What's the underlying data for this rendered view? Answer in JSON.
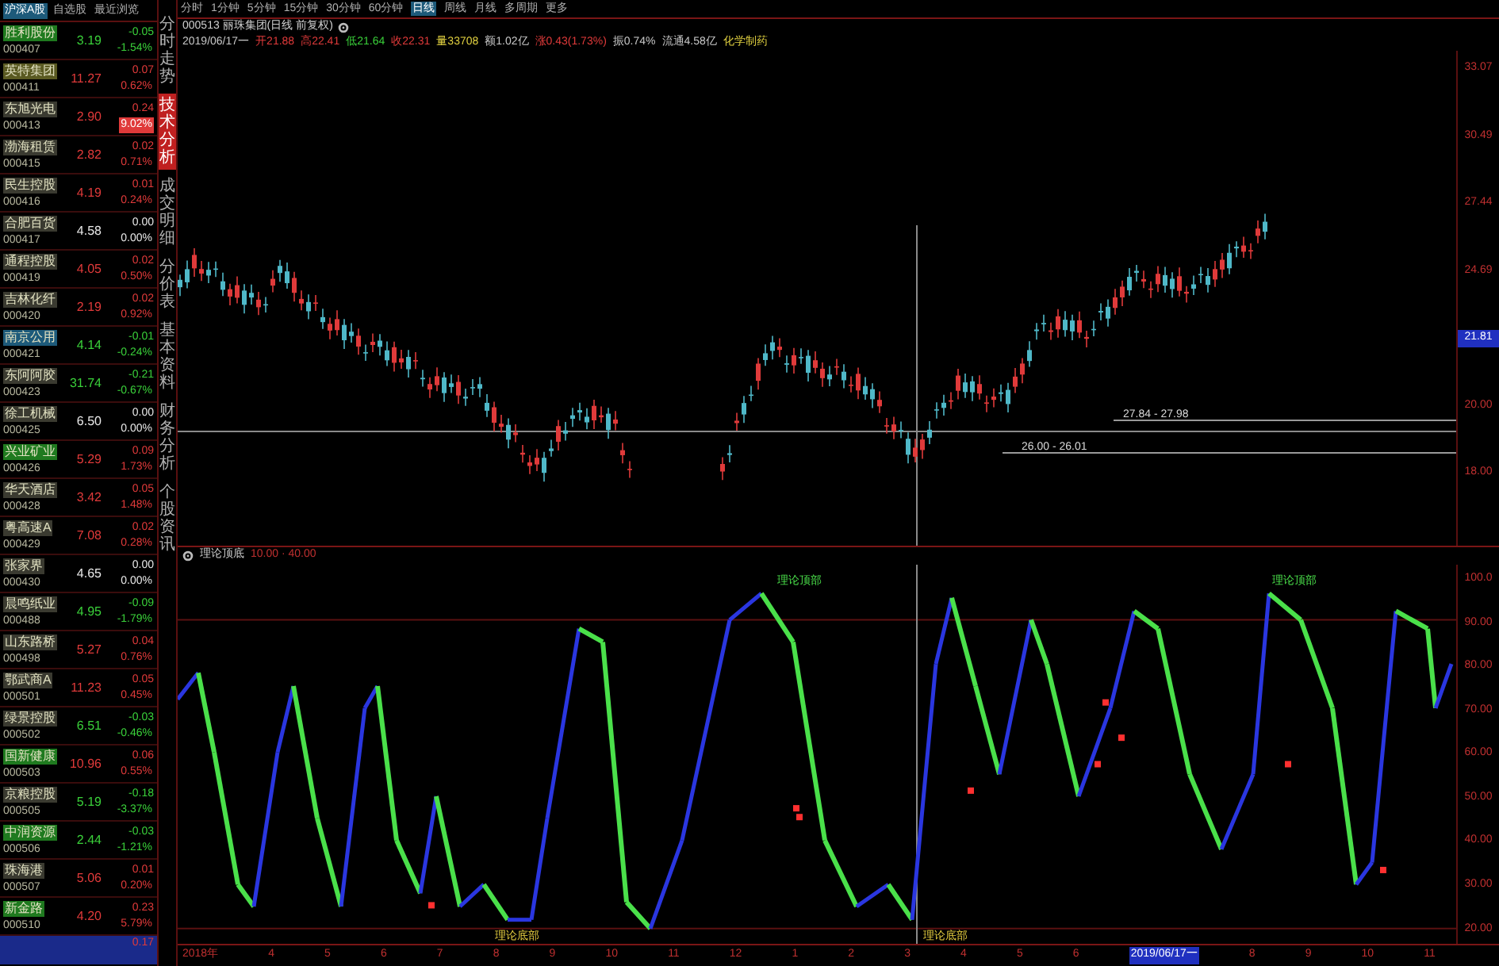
{
  "watchlist": {
    "tabs": [
      {
        "label": "沪深A股",
        "selected": true
      },
      {
        "label": "自选股",
        "selected": false
      },
      {
        "label": "最近浏览",
        "selected": false
      }
    ],
    "rows": [
      {
        "name": "胜利股份",
        "code": "000407",
        "price": "3.19",
        "change": "-0.05",
        "pct": "-1.54%",
        "kind": "down",
        "color": "#1f7a1f",
        "highlighted": false
      },
      {
        "name": "英特集团",
        "code": "000411",
        "price": "11.27",
        "change": "0.07",
        "pct": "0.62%",
        "kind": "up",
        "color": "#5a5a22",
        "highlighted": false
      },
      {
        "name": "东旭光电",
        "code": "000413",
        "price": "2.90",
        "change": "0.24",
        "pct": "9.02%",
        "kind": "up",
        "color": "#3a3a30",
        "highlighted": true
      },
      {
        "name": "渤海租赁",
        "code": "000415",
        "price": "2.82",
        "change": "0.02",
        "pct": "0.71%",
        "kind": "up",
        "color": "#3a3a30",
        "highlighted": false
      },
      {
        "name": "民生控股",
        "code": "000416",
        "price": "4.19",
        "change": "0.01",
        "pct": "0.24%",
        "kind": "up",
        "color": "#3a3a30",
        "highlighted": false
      },
      {
        "name": "合肥百货",
        "code": "000417",
        "price": "4.58",
        "change": "0.00",
        "pct": "0.00%",
        "kind": "flat",
        "color": "#3a3a30",
        "highlighted": false
      },
      {
        "name": "通程控股",
        "code": "000419",
        "price": "4.05",
        "change": "0.02",
        "pct": "0.50%",
        "kind": "up",
        "color": "#3a3a30",
        "highlighted": false
      },
      {
        "name": "吉林化纤",
        "code": "000420",
        "price": "2.19",
        "change": "0.02",
        "pct": "0.92%",
        "kind": "up",
        "color": "#3a3a30",
        "highlighted": false
      },
      {
        "name": "南京公用",
        "code": "000421",
        "price": "4.14",
        "change": "-0.01",
        "pct": "-0.24%",
        "kind": "down",
        "color": "#1d5a7a",
        "highlighted": false
      },
      {
        "name": "东阿阿胶",
        "code": "000423",
        "price": "31.74",
        "change": "-0.21",
        "pct": "-0.67%",
        "kind": "down",
        "color": "#3a3a30",
        "highlighted": false
      },
      {
        "name": "徐工机械",
        "code": "000425",
        "price": "6.50",
        "change": "0.00",
        "pct": "0.00%",
        "kind": "flat",
        "color": "#3a3a30",
        "highlighted": false
      },
      {
        "name": "兴业矿业",
        "code": "000426",
        "price": "5.29",
        "change": "0.09",
        "pct": "1.73%",
        "kind": "up",
        "color": "#1f7a1f",
        "highlighted": false
      },
      {
        "name": "华天酒店",
        "code": "000428",
        "price": "3.42",
        "change": "0.05",
        "pct": "1.48%",
        "kind": "up",
        "color": "#3a3a30",
        "highlighted": false
      },
      {
        "name": "粤高速A",
        "code": "000429",
        "price": "7.08",
        "change": "0.02",
        "pct": "0.28%",
        "kind": "up",
        "color": "#3a3a30",
        "highlighted": false
      },
      {
        "name": "张家界",
        "code": "000430",
        "price": "4.65",
        "change": "0.00",
        "pct": "0.00%",
        "kind": "flat",
        "color": "#3a3a30",
        "highlighted": false
      },
      {
        "name": "晨鸣纸业",
        "code": "000488",
        "price": "4.95",
        "change": "-0.09",
        "pct": "-1.79%",
        "kind": "down",
        "color": "#3a3a30",
        "highlighted": false
      },
      {
        "name": "山东路桥",
        "code": "000498",
        "price": "5.27",
        "change": "0.04",
        "pct": "0.76%",
        "kind": "up",
        "color": "#3a3a30",
        "highlighted": false
      },
      {
        "name": "鄂武商A",
        "code": "000501",
        "price": "11.23",
        "change": "0.05",
        "pct": "0.45%",
        "kind": "up",
        "color": "#3a3a30",
        "highlighted": false
      },
      {
        "name": "绿景控股",
        "code": "000502",
        "price": "6.51",
        "change": "-0.03",
        "pct": "-0.46%",
        "kind": "down",
        "color": "#3a3a30",
        "highlighted": false
      },
      {
        "name": "国新健康",
        "code": "000503",
        "price": "10.96",
        "change": "0.06",
        "pct": "0.55%",
        "kind": "up",
        "color": "#1f7a1f",
        "highlighted": false
      },
      {
        "name": "京粮控股",
        "code": "000505",
        "price": "5.19",
        "change": "-0.18",
        "pct": "-3.37%",
        "kind": "down",
        "color": "#3a3a30",
        "highlighted": false
      },
      {
        "name": "中润资源",
        "code": "000506",
        "price": "2.44",
        "change": "-0.03",
        "pct": "-1.21%",
        "kind": "down",
        "color": "#1f7a1f",
        "highlighted": false
      },
      {
        "name": "珠海港",
        "code": "000507",
        "price": "5.06",
        "change": "0.01",
        "pct": "0.20%",
        "kind": "up",
        "color": "#3a3a30",
        "highlighted": false
      },
      {
        "name": "新金路",
        "code": "000510",
        "price": "4.20",
        "change": "0.23",
        "pct": "5.79%",
        "kind": "up",
        "color": "#1f7a1f",
        "highlighted": false
      }
    ],
    "partial_row": {
      "change": "0.17"
    }
  },
  "side_tabs": [
    {
      "label": "分时走势",
      "selected": false
    },
    {
      "label": "技术分析",
      "selected": true
    },
    {
      "label": "成交明细",
      "selected": false
    },
    {
      "label": "分价表",
      "selected": false
    },
    {
      "label": "基本资料",
      "selected": false
    },
    {
      "label": "财务分析",
      "selected": false
    },
    {
      "label": "个股资讯",
      "selected": false
    }
  ],
  "period_bar": [
    {
      "label": "分时",
      "selected": false
    },
    {
      "label": "1分钟",
      "selected": false
    },
    {
      "label": "5分钟",
      "selected": false
    },
    {
      "label": "15分钟",
      "selected": false
    },
    {
      "label": "30分钟",
      "selected": false
    },
    {
      "label": "60分钟",
      "selected": false
    },
    {
      "label": "日线",
      "selected": true
    },
    {
      "label": "周线",
      "selected": false
    },
    {
      "label": "月线",
      "selected": false
    },
    {
      "label": "多周期",
      "selected": false
    },
    {
      "label": "更多",
      "selected": false
    }
  ],
  "title": "000513 丽珠集团(日线 前复权)",
  "quote_line": [
    {
      "text": "2019/06/17一",
      "kind": "neutral"
    },
    {
      "text": "开21.88",
      "kind": "up"
    },
    {
      "text": "高22.41",
      "kind": "up"
    },
    {
      "text": "低21.64",
      "kind": "down"
    },
    {
      "text": "收22.31",
      "kind": "up"
    },
    {
      "text": "量33708",
      "kind": "accent"
    },
    {
      "text": "额1.02亿",
      "kind": "neutral"
    },
    {
      "text": "涨0.43(1.73%)",
      "kind": "up"
    },
    {
      "text": "振0.74%",
      "kind": "neutral"
    },
    {
      "text": "流通4.58亿",
      "kind": "neutral"
    },
    {
      "text": "化学制药",
      "kind": "accent"
    }
  ],
  "price_chart": {
    "axis_labels": [
      {
        "label": "33.07",
        "highlighted": false
      },
      {
        "label": "30.49",
        "highlighted": false
      },
      {
        "label": "27.44",
        "highlighted": false
      },
      {
        "label": "24.69",
        "highlighted": false
      },
      {
        "label": "21.81",
        "highlighted": true
      },
      {
        "label": "20.00",
        "highlighted": false
      },
      {
        "label": "18.00",
        "highlighted": false
      }
    ],
    "range_labels": [
      "27.84 - 27.98",
      "26.00 - 26.01"
    ]
  },
  "indicator": {
    "name": "理论顶底",
    "params": "10.00 · 40.00",
    "axis_labels": [
      "100.0",
      "90.00",
      "80.00",
      "70.00",
      "60.00",
      "50.00",
      "40.00",
      "30.00",
      "20.00"
    ],
    "markers": [
      {
        "label": "理论顶部",
        "kind": "top"
      },
      {
        "label": "理论顶部",
        "kind": "top"
      },
      {
        "label": "理论底部",
        "kind": "bottom"
      },
      {
        "label": "理论底部",
        "kind": "bottom"
      }
    ]
  },
  "time_axis": [
    {
      "label": "2018年",
      "highlighted": false
    },
    {
      "label": "4",
      "highlighted": false
    },
    {
      "label": "5",
      "highlighted": false
    },
    {
      "label": "6",
      "highlighted": false
    },
    {
      "label": "7",
      "highlighted": false
    },
    {
      "label": "8",
      "highlighted": false
    },
    {
      "label": "9",
      "highlighted": false
    },
    {
      "label": "10",
      "highlighted": false
    },
    {
      "label": "11",
      "highlighted": false
    },
    {
      "label": "12",
      "highlighted": false
    },
    {
      "label": "1",
      "highlighted": false
    },
    {
      "label": "2",
      "highlighted": false
    },
    {
      "label": "3",
      "highlighted": false
    },
    {
      "label": "4",
      "highlighted": false
    },
    {
      "label": "5",
      "highlighted": false
    },
    {
      "label": "6",
      "highlighted": false
    },
    {
      "label": "2019/06/17一",
      "highlighted": true
    },
    {
      "label": "8",
      "highlighted": false
    },
    {
      "label": "9",
      "highlighted": false
    },
    {
      "label": "10",
      "highlighted": false
    },
    {
      "label": "11",
      "highlighted": false
    }
  ]
}
